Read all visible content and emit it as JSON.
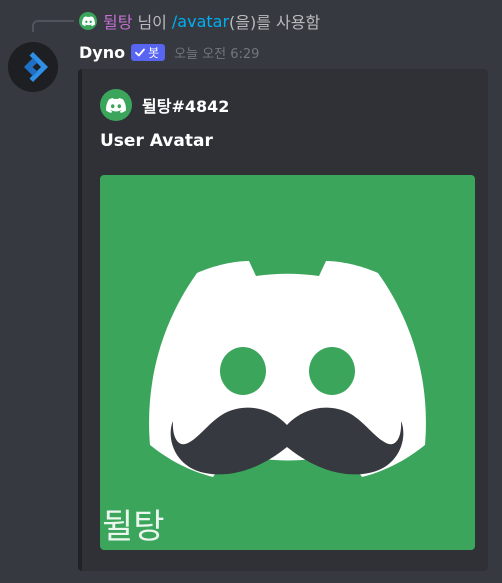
{
  "command_usage": {
    "user_name": "뒬탕",
    "middle_text": "님이",
    "command": "/avatar",
    "tail_text": "(을)를 사용함",
    "user_color": "#c271d1",
    "command_color": "#00aff4"
  },
  "message": {
    "author": "Dyno",
    "badge_label": "봇",
    "timestamp": "오늘 오전 6:29",
    "avatar_icon": "dyno-logo-icon",
    "badge_color": "#5865f2"
  },
  "embed": {
    "author_name": "뒬탕#4842",
    "author_icon": "discord-logo-icon",
    "title": "User Avatar",
    "image": {
      "description_icon": "discord-mustache-logo-icon",
      "background_color": "#3ba55c",
      "caption": "뒬탕"
    }
  }
}
